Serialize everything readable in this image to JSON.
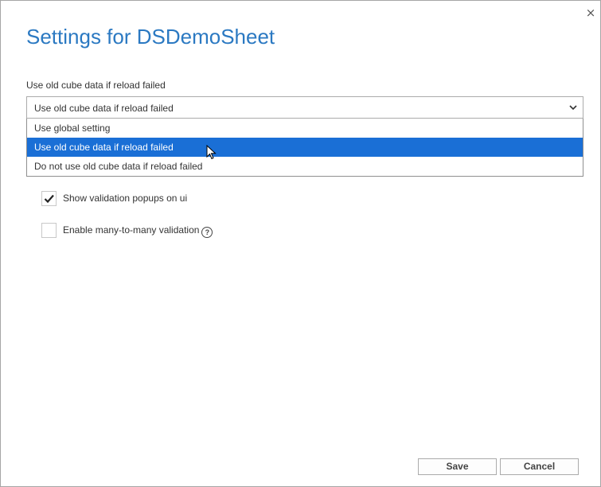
{
  "dialog": {
    "title": "Settings for DSDemoSheet",
    "close_glyph": "×"
  },
  "reload_setting": {
    "label": "Use old cube data if reload failed",
    "selected_value": "Use old cube data if reload failed",
    "options": [
      "Use global setting",
      "Use old cube data if reload failed",
      "Do not use old cube data if reload failed"
    ],
    "selected_index": 1
  },
  "checkboxes": [
    {
      "label": "Show validation popups on ui",
      "checked": true
    },
    {
      "label": "Enable many-to-many validation",
      "checked": false,
      "has_help_icon": true
    }
  ],
  "help_icon_glyph": "?",
  "buttons": {
    "save": "Save",
    "cancel": "Cancel"
  },
  "colors": {
    "title": "#2b79c2",
    "selected_option_bg": "#1a6fd6"
  }
}
